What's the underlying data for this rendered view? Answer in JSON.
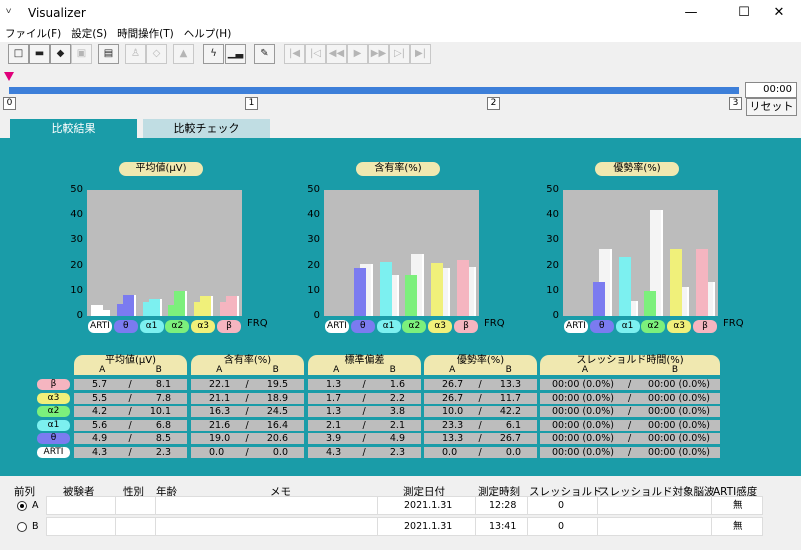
{
  "window": {
    "title": "Visualizer",
    "icon": "visualizer-app-icon"
  },
  "menu": [
    "ファイル(F)",
    "設定(S)",
    "時間操作(T)",
    "ヘルプ(H)"
  ],
  "toolbar": [
    {
      "icon": "new-file-icon",
      "glyph": "□",
      "disabled": false
    },
    {
      "icon": "open-folder-icon",
      "glyph": "▬",
      "disabled": false
    },
    {
      "icon": "layers-icon",
      "glyph": "◆",
      "disabled": false
    },
    {
      "icon": "save-icon",
      "glyph": "▣",
      "disabled": true
    },
    {
      "icon": "print-icon",
      "glyph": "▤",
      "disabled": false
    },
    {
      "icon": "person-icon",
      "glyph": "♙",
      "disabled": true
    },
    {
      "icon": "shield-icon",
      "glyph": "◇",
      "disabled": true
    },
    {
      "icon": "triangle-icon",
      "glyph": "▲",
      "disabled": true
    },
    {
      "icon": "lightning-icon",
      "glyph": "ϟ",
      "disabled": false
    },
    {
      "icon": "bar-chart-icon",
      "glyph": "▁▃",
      "disabled": false
    },
    {
      "icon": "plug-icon",
      "glyph": "✎",
      "disabled": false
    },
    {
      "icon": "skip-start-icon",
      "glyph": "|◀",
      "disabled": true
    },
    {
      "icon": "step-back-icon",
      "glyph": "|◁",
      "disabled": true
    },
    {
      "icon": "rewind-icon",
      "glyph": "◀◀",
      "disabled": true
    },
    {
      "icon": "play-icon",
      "glyph": "▶",
      "disabled": true
    },
    {
      "icon": "forward-icon",
      "glyph": "▶▶",
      "disabled": true
    },
    {
      "icon": "step-forward-icon",
      "glyph": "▷|",
      "disabled": true
    },
    {
      "icon": "skip-end-icon",
      "glyph": "▶|",
      "disabled": true
    }
  ],
  "timeline": {
    "ticks": [
      "0",
      "1",
      "2",
      "3"
    ],
    "time": "00:00",
    "reset_label": "リセット"
  },
  "tabs": [
    "比較結果",
    "比較チェック"
  ],
  "colors": {
    "theta": "#7b7bf0",
    "alpha1": "#7cf0f0",
    "alpha2": "#7cf07c",
    "alpha3": "#f0f07a",
    "beta": "#f5b5c0",
    "arti": "#ffffff",
    "panel": "#1a9ca8"
  },
  "chart_data": [
    {
      "type": "bar",
      "title": "平均値(μV)",
      "ylim": [
        0,
        50
      ],
      "yticks": [
        "0",
        "10",
        "20",
        "30",
        "40",
        "50"
      ],
      "xlabel": "FRQ",
      "categories": [
        "ARTI",
        "θ",
        "α1",
        "α2",
        "α3",
        "β"
      ],
      "series": [
        {
          "name": "A",
          "values": [
            4.3,
            4.9,
            5.6,
            4.2,
            5.5,
            5.7
          ]
        },
        {
          "name": "B",
          "values": [
            2.3,
            8.5,
            6.8,
            10.1,
            7.8,
            8.1
          ]
        }
      ]
    },
    {
      "type": "bar",
      "title": "含有率(%)",
      "ylim": [
        0,
        50
      ],
      "yticks": [
        "0",
        "10",
        "20",
        "30",
        "40",
        "50"
      ],
      "xlabel": "FRQ",
      "categories": [
        "ARTI",
        "θ",
        "α1",
        "α2",
        "α3",
        "β"
      ],
      "series": [
        {
          "name": "A",
          "values": [
            0.0,
            19.0,
            21.6,
            16.3,
            21.1,
            22.1
          ]
        },
        {
          "name": "B",
          "values": [
            0.0,
            20.6,
            16.4,
            24.5,
            18.9,
            19.5
          ]
        }
      ]
    },
    {
      "type": "bar",
      "title": "優勢率(%)",
      "ylim": [
        0,
        50
      ],
      "yticks": [
        "0",
        "10",
        "20",
        "30",
        "40",
        "50"
      ],
      "xlabel": "FRQ",
      "categories": [
        "ARTI",
        "θ",
        "α1",
        "α2",
        "α3",
        "β"
      ],
      "series": [
        {
          "name": "A",
          "values": [
            0.0,
            13.3,
            23.3,
            10.0,
            26.7,
            26.7
          ]
        },
        {
          "name": "B",
          "values": [
            0.0,
            26.7,
            6.1,
            42.2,
            11.7,
            13.3
          ]
        }
      ]
    }
  ],
  "table": {
    "headers": [
      "平均値(μV)",
      "含有率(%)",
      "標準偏差",
      "優勢率(%)",
      "スレッショルド時間(%)"
    ],
    "sub": [
      "A",
      "B"
    ],
    "sep": "/",
    "rows": [
      {
        "label": "β",
        "key": "beta",
        "cols": [
          [
            "5.7",
            "8.1"
          ],
          [
            "22.1",
            "19.5"
          ],
          [
            "1.3",
            "1.6"
          ],
          [
            "26.7",
            "13.3"
          ],
          [
            "00:00 (0.0%)",
            "00:00 (0.0%)"
          ]
        ]
      },
      {
        "label": "α3",
        "key": "alpha3",
        "cols": [
          [
            "5.5",
            "7.8"
          ],
          [
            "21.1",
            "18.9"
          ],
          [
            "1.7",
            "2.2"
          ],
          [
            "26.7",
            "11.7"
          ],
          [
            "00:00 (0.0%)",
            "00:00 (0.0%)"
          ]
        ]
      },
      {
        "label": "α2",
        "key": "alpha2",
        "cols": [
          [
            "4.2",
            "10.1"
          ],
          [
            "16.3",
            "24.5"
          ],
          [
            "1.3",
            "3.8"
          ],
          [
            "10.0",
            "42.2"
          ],
          [
            "00:00 (0.0%)",
            "00:00 (0.0%)"
          ]
        ]
      },
      {
        "label": "α1",
        "key": "alpha1",
        "cols": [
          [
            "5.6",
            "6.8"
          ],
          [
            "21.6",
            "16.4"
          ],
          [
            "2.1",
            "2.1"
          ],
          [
            "23.3",
            "6.1"
          ],
          [
            "00:00 (0.0%)",
            "00:00 (0.0%)"
          ]
        ]
      },
      {
        "label": "θ",
        "key": "theta",
        "cols": [
          [
            "4.9",
            "8.5"
          ],
          [
            "19.0",
            "20.6"
          ],
          [
            "3.9",
            "4.9"
          ],
          [
            "13.3",
            "26.7"
          ],
          [
            "00:00 (0.0%)",
            "00:00 (0.0%)"
          ]
        ]
      },
      {
        "label": "ARTI",
        "key": "arti",
        "cols": [
          [
            "4.3",
            "2.3"
          ],
          [
            "0.0",
            "0.0"
          ],
          [
            "4.3",
            "2.3"
          ],
          [
            "0.0",
            "0.0"
          ],
          [
            "00:00 (0.0%)",
            "00:00 (0.0%)"
          ]
        ]
      }
    ]
  },
  "records": {
    "headers": [
      "前列",
      "被験者",
      "性別",
      "年齢",
      "メモ",
      "測定日付",
      "測定時刻",
      "スレッショルド",
      "スレッショルド対象脳波",
      "ARTI感度"
    ],
    "rows": [
      {
        "label": "A",
        "selected": true,
        "date": "2021.1.31",
        "time": "12:28",
        "threshold": "0",
        "arti": "無"
      },
      {
        "label": "B",
        "selected": false,
        "date": "2021.1.31",
        "time": "13:41",
        "threshold": "0",
        "arti": "無"
      }
    ]
  }
}
